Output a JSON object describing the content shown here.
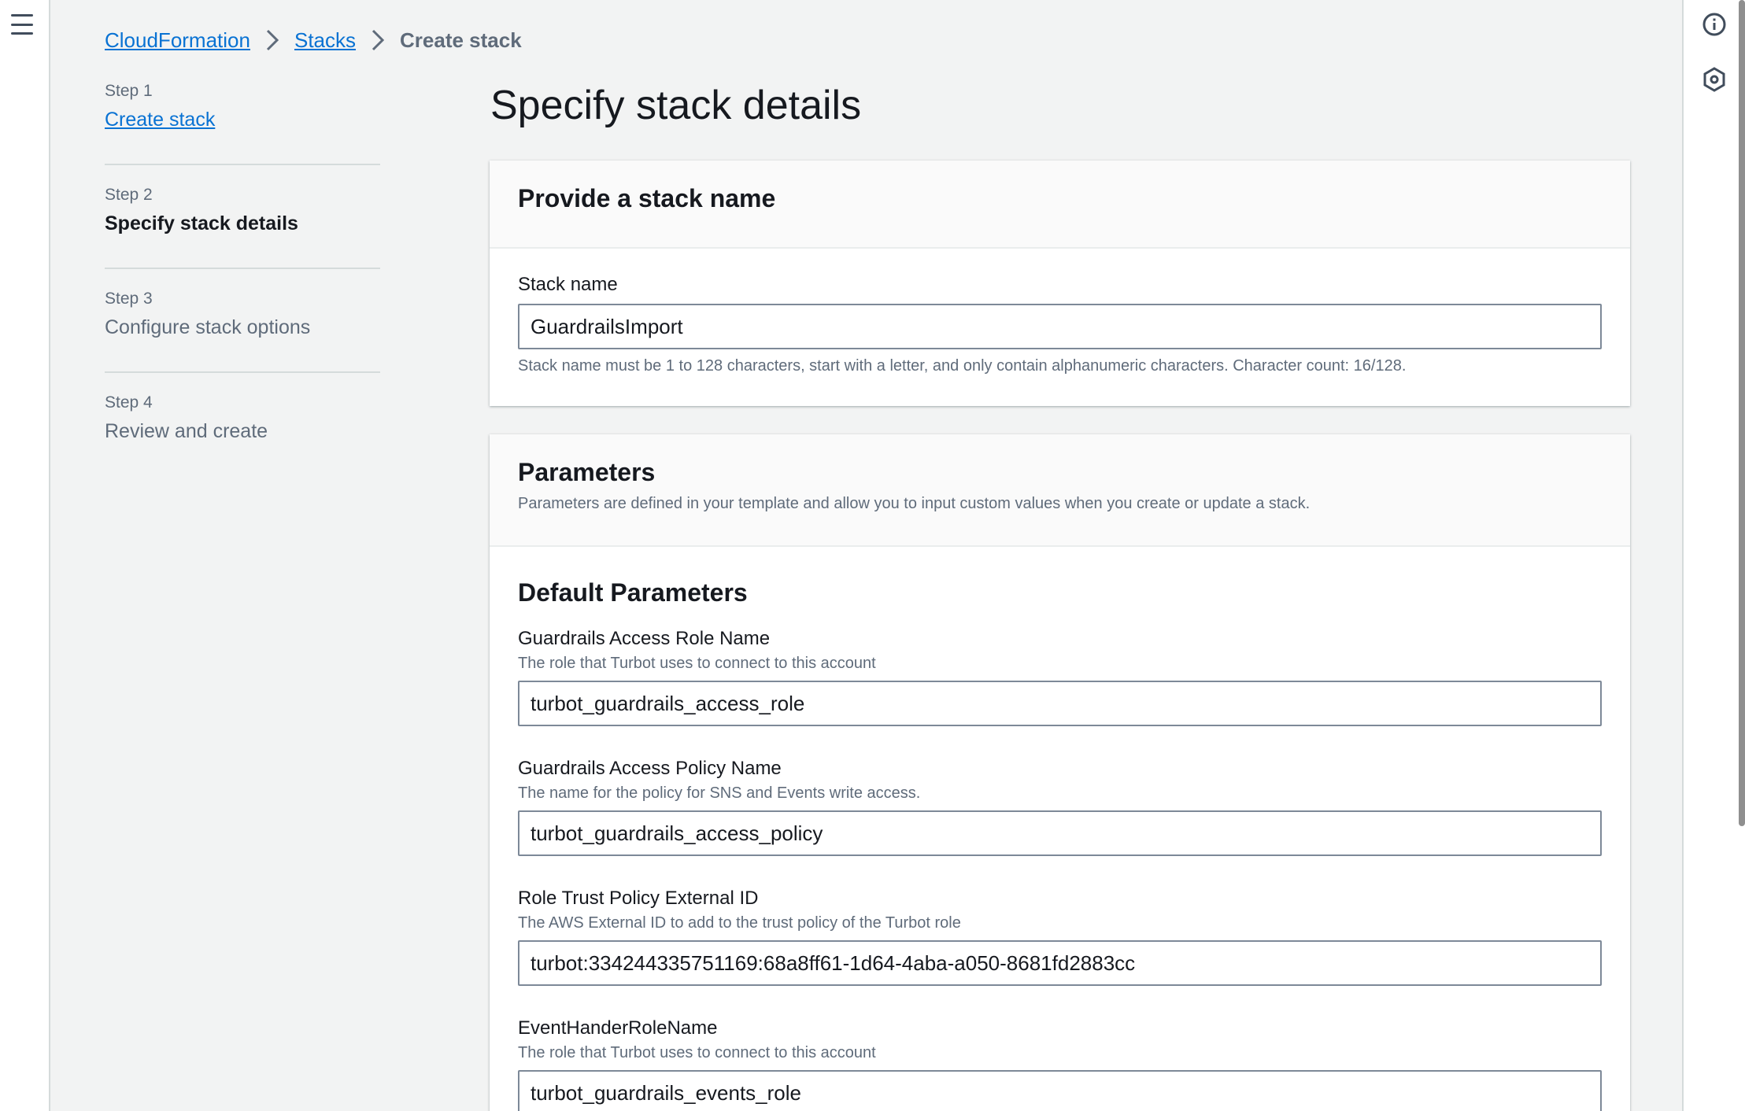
{
  "breadcrumb": {
    "items": [
      "CloudFormation",
      "Stacks"
    ],
    "current": "Create stack"
  },
  "steps": [
    {
      "number": "Step 1",
      "title": "Create stack"
    },
    {
      "number": "Step 2",
      "title": "Specify stack details"
    },
    {
      "number": "Step 3",
      "title": "Configure stack options"
    },
    {
      "number": "Step 4",
      "title": "Review and create"
    }
  ],
  "page": {
    "title": "Specify stack details"
  },
  "stack_name_section": {
    "title": "Provide a stack name",
    "label": "Stack name",
    "value": "GuardrailsImport",
    "constraint": "Stack name must be 1 to 128 characters, start with a letter, and only contain alphanumeric characters. Character count: 16/128."
  },
  "parameters_section": {
    "title": "Parameters",
    "description": "Parameters are defined in your template and allow you to input custom values when you create or update a stack.",
    "group_title": "Default Parameters",
    "fields": [
      {
        "label": "Guardrails Access Role Name",
        "description": "The role that Turbot uses to connect to this account",
        "value": "turbot_guardrails_access_role"
      },
      {
        "label": "Guardrails Access Policy Name",
        "description": "The name for the policy for SNS and Events write access.",
        "value": "turbot_guardrails_access_policy"
      },
      {
        "label": "Role Trust Policy External ID",
        "description": "The AWS External ID to add to the trust policy of the Turbot role",
        "value": "turbot:334244335751169:68a8ff61-1d64-4aba-a050-8681fd2883cc"
      },
      {
        "label": "EventHanderRoleName",
        "description": "The role that Turbot uses to connect to this account",
        "value": "turbot_guardrails_events_role"
      }
    ]
  },
  "colors": {
    "link": "#0972d3",
    "background": "#f2f3f3",
    "text": "#16191f",
    "muted": "#5f6b7a"
  },
  "icons": [
    "menu-icon",
    "chevron-right-icon",
    "info-icon",
    "settings-hexagon-icon"
  ]
}
